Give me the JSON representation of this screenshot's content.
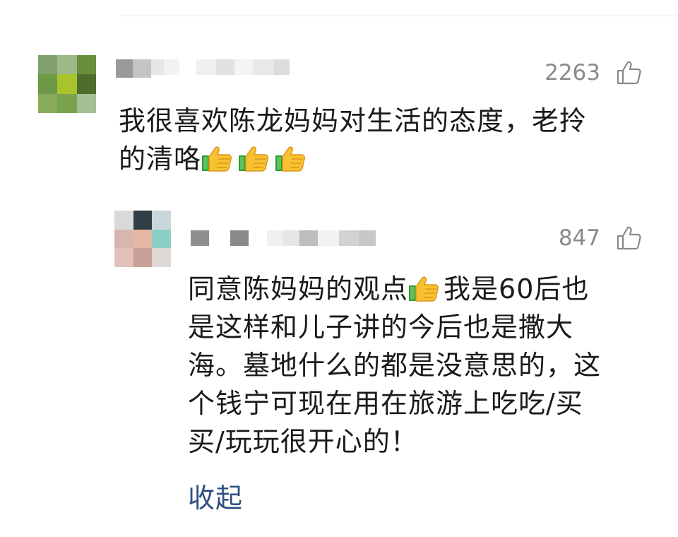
{
  "comments": [
    {
      "like_count": "2263",
      "text_lines": [
        "我很喜欢陈龙妈妈对生活的态度，老拎",
        "的清咯"
      ],
      "emoji_count": 3,
      "emoji": "thumbs-up-icon"
    },
    {
      "like_count": "847",
      "text_part1": "同意陈妈妈的观点",
      "text_part2": "我是60后也",
      "text_lines": [
        "是这样和儿子讲的今后也是撒大",
        "海。墓地什么的都是没意思的，这",
        "个钱宁可现在用在旅游上吃吃/买",
        "买/玩玩很开心的！"
      ],
      "emoji": "thumbs-up-icon"
    }
  ],
  "collapse_label": "收起",
  "colors": {
    "text": "#1a1a1a",
    "count": "#8a8a8a",
    "link": "#2f4f7f",
    "divider": "#ececec"
  },
  "icons": {
    "like": "thumb-up-outline-icon"
  }
}
